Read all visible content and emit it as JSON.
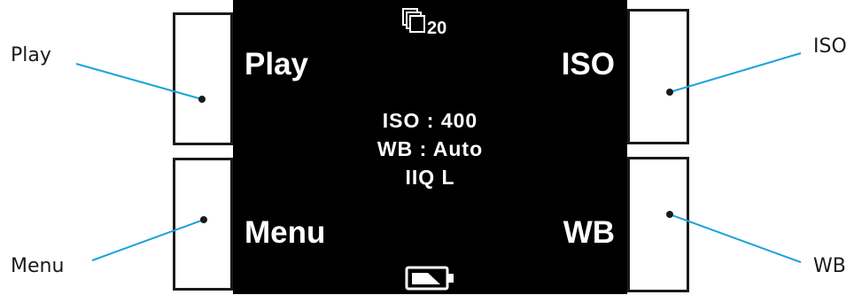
{
  "callouts": {
    "play": "Play",
    "menu": "Menu",
    "iso": "ISO",
    "wb": "WB"
  },
  "screen": {
    "top_left": "Play",
    "top_right": "ISO",
    "bottom_left": "Menu",
    "bottom_right": "WB",
    "shot_counter": "20",
    "settings": {
      "iso": "ISO : 400",
      "wb": "WB : Auto",
      "format": "IIQ L"
    }
  },
  "icons": {
    "top": "image-stack-icon",
    "bottom": "battery-icon"
  },
  "colors": {
    "leader_line": "#1aa3d9",
    "screen_bg": "#000000",
    "screen_text": "#ffffff"
  }
}
